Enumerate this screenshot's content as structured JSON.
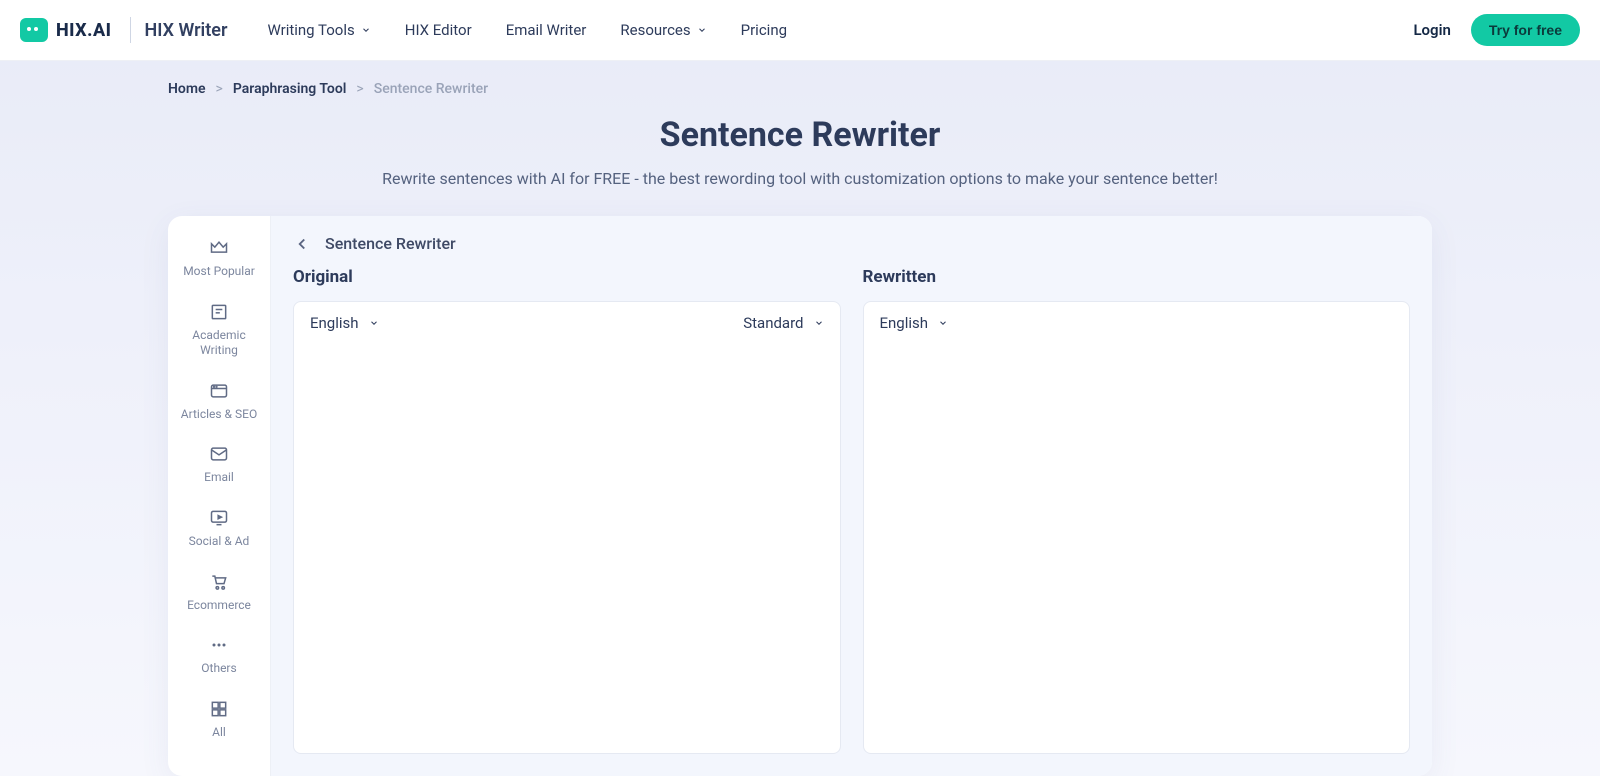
{
  "header": {
    "brand": "HIX.AI",
    "sub_brand": "HIX Writer",
    "nav": [
      {
        "label": "Writing Tools",
        "dropdown": true
      },
      {
        "label": "HIX Editor",
        "dropdown": false
      },
      {
        "label": "Email Writer",
        "dropdown": false
      },
      {
        "label": "Resources",
        "dropdown": true
      },
      {
        "label": "Pricing",
        "dropdown": false
      }
    ],
    "login": "Login",
    "try_free": "Try for free"
  },
  "breadcrumb": {
    "items": [
      {
        "label": "Home"
      },
      {
        "label": "Paraphrasing Tool"
      }
    ],
    "current": "Sentence Rewriter",
    "separator": ">"
  },
  "page": {
    "title": "Sentence Rewriter",
    "subtitle": "Rewrite sentences with AI for FREE - the best rewording tool with customization options to make your sentence better!"
  },
  "sidebar": {
    "items": [
      {
        "label": "Most Popular"
      },
      {
        "label": "Academic Writing"
      },
      {
        "label": "Articles & SEO"
      },
      {
        "label": "Email"
      },
      {
        "label": "Social & Ad"
      },
      {
        "label": "Ecommerce"
      },
      {
        "label": "Others"
      },
      {
        "label": "All"
      }
    ]
  },
  "editor": {
    "back_title": "Sentence Rewriter",
    "original": {
      "heading": "Original",
      "language": "English",
      "tone": "Standard"
    },
    "rewritten": {
      "heading": "Rewritten",
      "language": "English"
    }
  }
}
